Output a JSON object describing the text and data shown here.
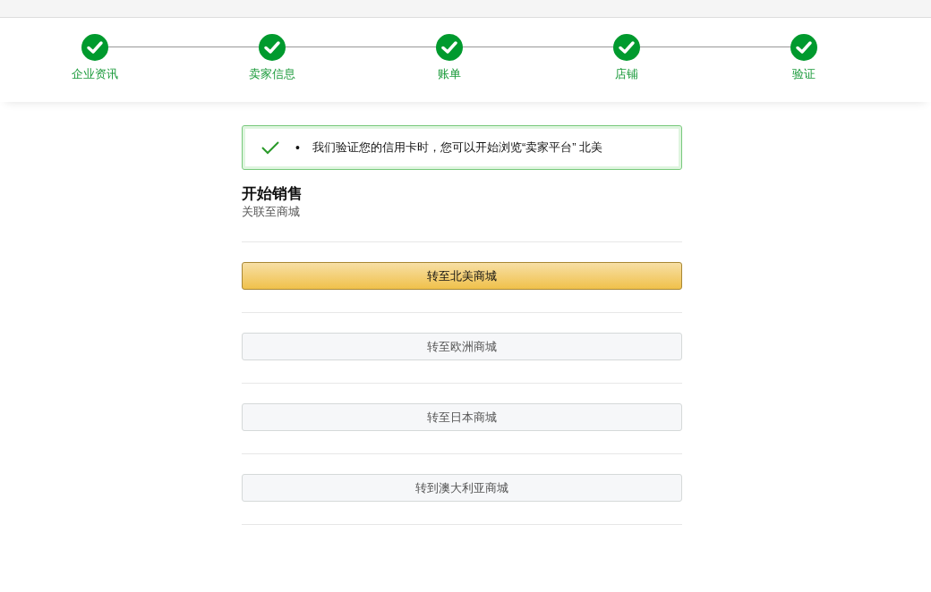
{
  "steps": [
    {
      "label": "企业资讯",
      "done": true
    },
    {
      "label": "卖家信息",
      "done": true
    },
    {
      "label": "账单",
      "done": true
    },
    {
      "label": "店铺",
      "done": true
    },
    {
      "label": "验证",
      "done": true
    }
  ],
  "alert": {
    "kind": "success",
    "bullet": "•",
    "message": "我们验证您的信用卡时，您可以开始浏览“卖家平台” 北美"
  },
  "heading": "开始销售",
  "subheading": "关联至商城",
  "buttons": [
    {
      "label": "转至北美商城",
      "kind": "primary"
    },
    {
      "label": "转至欧洲商城",
      "kind": "secondary"
    },
    {
      "label": "转至日本商城",
      "kind": "secondary"
    },
    {
      "label": "转到澳大利亚商城",
      "kind": "secondary"
    }
  ]
}
